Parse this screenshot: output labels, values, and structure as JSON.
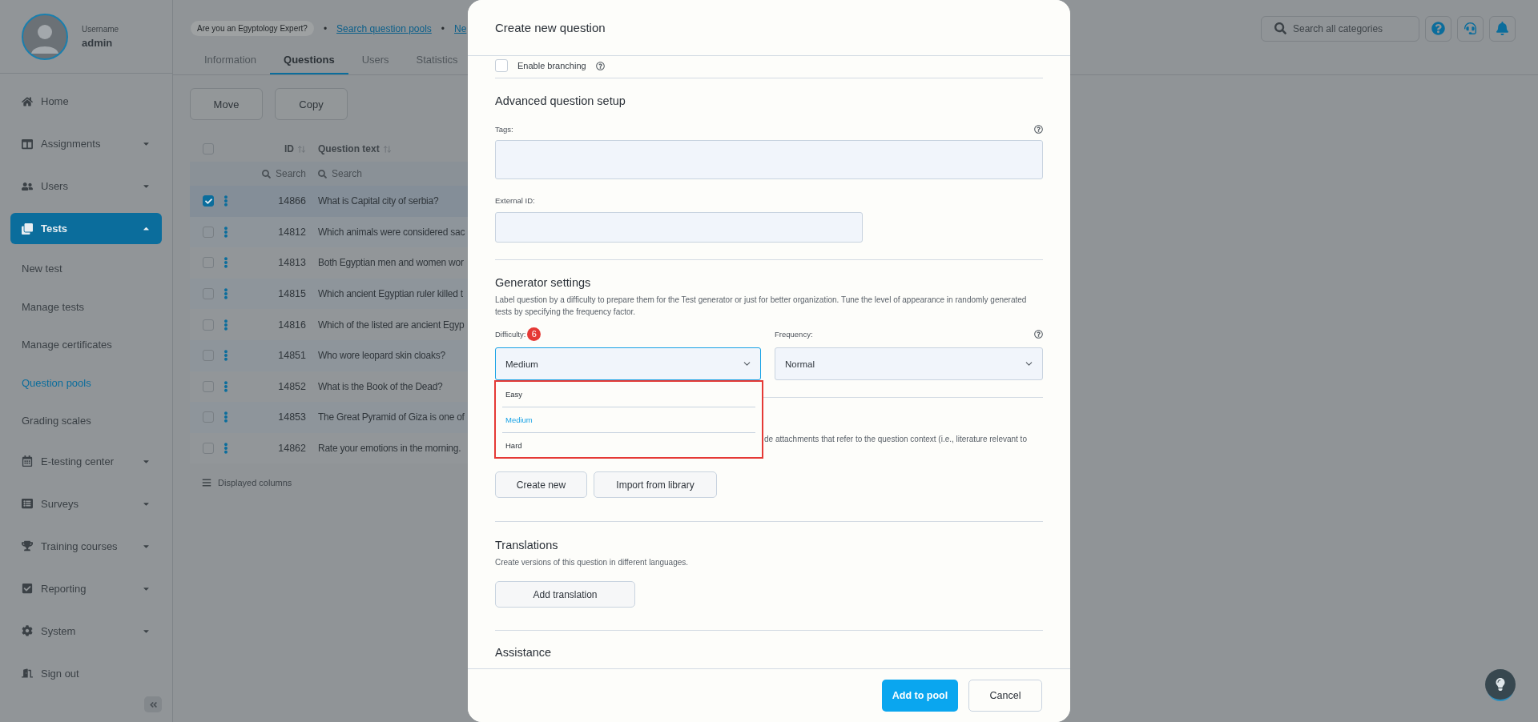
{
  "sidebar": {
    "user": {
      "label": "Username",
      "name": "admin"
    },
    "items": [
      {
        "kind": "link",
        "label": "Home"
      },
      {
        "kind": "group",
        "label": "Assignments",
        "expanded": false,
        "selected": false
      },
      {
        "kind": "group",
        "label": "Users",
        "expanded": false,
        "selected": false
      },
      {
        "kind": "group",
        "label": "Tests",
        "expanded": true,
        "selected": true
      },
      {
        "kind": "subitem",
        "label": "New test",
        "selected": false
      },
      {
        "kind": "subitem",
        "label": "Manage tests",
        "selected": false
      },
      {
        "kind": "subitem",
        "label": "Manage certificates",
        "selected": false
      },
      {
        "kind": "subitem",
        "label": "Question pools",
        "selected": true
      },
      {
        "kind": "subitem",
        "label": "Grading scales",
        "selected": false
      },
      {
        "kind": "group",
        "label": "E-testing center",
        "expanded": false,
        "selected": false
      },
      {
        "kind": "group",
        "label": "Surveys",
        "expanded": false,
        "selected": false
      },
      {
        "kind": "group",
        "label": "Training courses",
        "expanded": false,
        "selected": false
      },
      {
        "kind": "group",
        "label": "Reporting",
        "expanded": false,
        "selected": false
      },
      {
        "kind": "group",
        "label": "System",
        "expanded": false,
        "selected": false
      },
      {
        "kind": "link",
        "label": "Sign out"
      }
    ]
  },
  "banner": {
    "tag": "Are you an Egyptology Expert?",
    "links": [
      {
        "bullet": "•",
        "label": "Search question pools"
      },
      {
        "bullet": "•",
        "label": "Ne"
      }
    ]
  },
  "header_tools": {
    "search_placeholder": "Search all categories"
  },
  "tabs": [
    {
      "label": "Information",
      "selected": false
    },
    {
      "label": "Questions",
      "selected": true
    },
    {
      "label": "Users",
      "selected": false
    },
    {
      "label": "Statistics",
      "selected": false
    }
  ],
  "actions": [
    "Move",
    "Copy"
  ],
  "table": {
    "select_all_checked": false,
    "columns": [
      "ID",
      "Question text"
    ],
    "search_placeholders": [
      "Search",
      "Search"
    ],
    "rows": [
      {
        "id": "14866",
        "text": "What is Capital city of serbia?",
        "checked": true
      },
      {
        "id": "14812",
        "text": "Which animals were considered sac",
        "checked": false
      },
      {
        "id": "14813",
        "text": "Both Egyptian men and women wor",
        "checked": false
      },
      {
        "id": "14815",
        "text": "Which ancient Egyptian ruler killed t",
        "checked": false
      },
      {
        "id": "14816",
        "text": "Which of the listed are ancient Egyp",
        "checked": false
      },
      {
        "id": "14851",
        "text": "Who wore leopard skin cloaks?",
        "checked": false
      },
      {
        "id": "14852",
        "text": "What is the Book of the Dead?",
        "checked": false
      },
      {
        "id": "14853",
        "text": "The Great Pyramid of Giza is one of",
        "checked": false
      },
      {
        "id": "14862",
        "text": "Rate your emotions in the morning.",
        "checked": false
      }
    ],
    "footer": "Displayed columns"
  },
  "modal": {
    "title": "Create new question",
    "branching": {
      "label": "Enable branching",
      "checked": false
    },
    "advanced": {
      "heading": "Advanced question setup",
      "tags_label": "Tags:",
      "external_id_label": "External ID:"
    },
    "generator": {
      "heading": "Generator settings",
      "description": "Label question by a difficulty to prepare them for the Test generator or just for better organization. Tune the level of appearance in randomly generated tests by specifying the frequency factor.",
      "difficulty": {
        "label": "Difficulty:",
        "badge": "6",
        "value": "Medium",
        "expanded": true,
        "options": [
          {
            "label": "Easy",
            "selected": false
          },
          {
            "label": "Medium",
            "selected": true
          },
          {
            "label": "Hard",
            "selected": false
          }
        ]
      },
      "frequency": {
        "label": "Frequency:",
        "value": "Normal"
      }
    },
    "attachments": {
      "description": "de attachments that refer to the question context (i.e., literature relevant to",
      "buttons": [
        "Create new",
        "Import from library"
      ]
    },
    "translations": {
      "heading": "Translations",
      "description": "Create versions of this question in different languages.",
      "button": "Add translation"
    },
    "assistance": {
      "heading": "Assistance"
    },
    "footer": {
      "primary": "Add to pool",
      "secondary": "Cancel"
    }
  }
}
